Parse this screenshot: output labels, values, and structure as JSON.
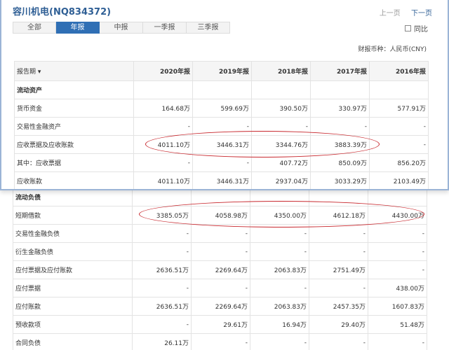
{
  "header": {
    "title": "容川机电(NQ834372)",
    "prev_label": "上一页",
    "next_label": "下一页"
  },
  "tabs": [
    {
      "label": "全部",
      "active": false
    },
    {
      "label": "年报",
      "active": true
    },
    {
      "label": "中报",
      "active": false
    },
    {
      "label": "一季报",
      "active": false
    },
    {
      "label": "三季报",
      "active": false
    }
  ],
  "compare_label": "同比",
  "currency_label": "财报币种：人民币(CNY)",
  "table": {
    "header_label": "报告期 ▾",
    "periods": [
      "2020年报",
      "2019年报",
      "2018年报",
      "2017年报",
      "2016年报"
    ],
    "top_rows": [
      {
        "label": "流动资产",
        "section": true,
        "values": [
          "",
          "",
          "",
          "",
          ""
        ]
      },
      {
        "label": "货币资金",
        "values": [
          "164.68万",
          "599.69万",
          "390.50万",
          "330.97万",
          "577.91万"
        ]
      },
      {
        "label": "交易性金融资产",
        "values": [
          "-",
          "-",
          "-",
          "-",
          "-"
        ]
      },
      {
        "label": "应收票据及应收账款",
        "values": [
          "4011.10万",
          "3446.31万",
          "3344.76万",
          "3883.39万",
          "-"
        ]
      },
      {
        "label": "其中：应收票据",
        "values": [
          "-",
          "-",
          "407.72万",
          "850.09万",
          "856.20万"
        ]
      },
      {
        "label": "应收账款",
        "values": [
          "4011.10万",
          "3446.31万",
          "2937.04万",
          "3033.29万",
          "2103.49万"
        ]
      }
    ],
    "bottom_rows": [
      {
        "label": "流动负债",
        "section": true,
        "values": [
          "",
          "",
          "",
          "",
          ""
        ]
      },
      {
        "label": "短期借款",
        "values": [
          "3385.05万",
          "4058.98万",
          "4350.00万",
          "4612.18万",
          "4430.00万"
        ]
      },
      {
        "label": "交易性金融负债",
        "values": [
          "-",
          "-",
          "-",
          "-",
          "-"
        ]
      },
      {
        "label": "衍生金融负债",
        "values": [
          "-",
          "-",
          "-",
          "-",
          "-"
        ]
      },
      {
        "label": "应付票据及应付账款",
        "values": [
          "2636.51万",
          "2269.64万",
          "2063.83万",
          "2751.49万",
          "-"
        ]
      },
      {
        "label": "应付票据",
        "values": [
          "-",
          "-",
          "-",
          "-",
          "438.00万"
        ]
      },
      {
        "label": "应付账款",
        "values": [
          "2636.51万",
          "2269.64万",
          "2063.83万",
          "2457.35万",
          "1607.83万"
        ]
      },
      {
        "label": "预收款项",
        "values": [
          "-",
          "29.61万",
          "16.94万",
          "29.40万",
          "51.48万"
        ]
      },
      {
        "label": "合同负债",
        "values": [
          "26.11万",
          "-",
          "-",
          "-",
          "-"
        ]
      }
    ]
  }
}
